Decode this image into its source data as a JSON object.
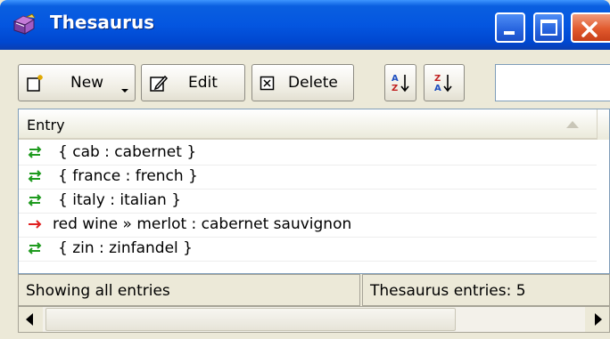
{
  "window": {
    "title": "Thesaurus",
    "icon": "thesaurus-book-icon",
    "controls": [
      "minimize-icon",
      "maximize-icon",
      "close-icon"
    ]
  },
  "toolbar": {
    "new_label": "New",
    "edit_label": "Edit",
    "delete_label": "Delete",
    "sort_ascending_icon": "sort-az-icon",
    "sort_descending_icon": "sort-za-icon",
    "search_value": ""
  },
  "list": {
    "column_header": "Entry",
    "rows": [
      {
        "type": "synonym",
        "icon": "bidirectional-arrow-icon",
        "text": "{ cab : cabernet }"
      },
      {
        "type": "synonym",
        "icon": "bidirectional-arrow-icon",
        "text": "{ france : french }"
      },
      {
        "type": "synonym",
        "icon": "bidirectional-arrow-icon",
        "text": "{ italy : italian }"
      },
      {
        "type": "replacement",
        "icon": "right-arrow-icon",
        "text": "red wine  »  merlot : cabernet sauvignon"
      },
      {
        "type": "synonym",
        "icon": "bidirectional-arrow-icon",
        "text": "{ zin : zinfandel }"
      }
    ]
  },
  "status": {
    "left": "Showing all entries",
    "right": "Thesaurus entries: 5"
  },
  "colors": {
    "titlebar": "#0456E0",
    "synonym_arrow": "#1E9A1E",
    "replacement_arrow": "#E02020"
  }
}
